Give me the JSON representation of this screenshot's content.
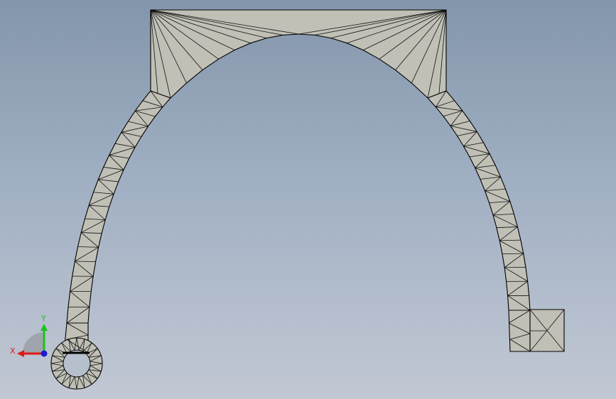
{
  "viewport": {
    "model_fill": "#c0c0b6",
    "mesh_stroke": "#111111",
    "background_top": "#8496ac",
    "background_bottom": "#c2c8d4"
  },
  "triad": {
    "x_label": "X",
    "y_label": "Y",
    "x_color": "#e01818",
    "y_color": "#1cc21c",
    "z_color": "#1a1ad0"
  }
}
